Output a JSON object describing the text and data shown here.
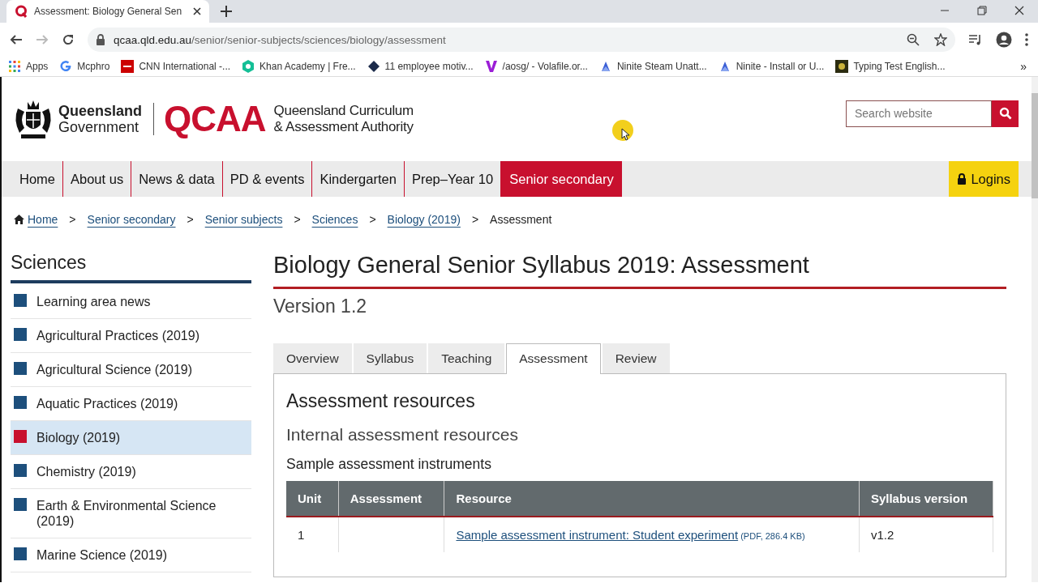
{
  "browser": {
    "tab": {
      "title": "Assessment: Biology General Sen",
      "selected": true
    },
    "url_host": "qcaa.qld.edu.au",
    "url_path": "/senior/senior-subjects/sciences/biology/assessment",
    "bookmarks": [
      {
        "label": "Apps",
        "kind": "apps"
      },
      {
        "label": "Mcphro",
        "kind": "g"
      },
      {
        "label": "CNN International -...",
        "kind": "cnn"
      },
      {
        "label": "Khan Academy | Fre...",
        "kind": "khan"
      },
      {
        "label": "11 employee motiv...",
        "kind": "diamond"
      },
      {
        "label": "/aosg/ - Volafile.or...",
        "kind": "v"
      },
      {
        "label": "Ninite Steam Unatt...",
        "kind": "ninite"
      },
      {
        "label": "Ninite - Install or U...",
        "kind": "ninite"
      },
      {
        "label": "Typing Test English...",
        "kind": "typing"
      }
    ],
    "more": "»"
  },
  "header": {
    "gov_line1": "Queensland",
    "gov_line2": "Government",
    "logo": "QCAA",
    "org_line1": "Queensland Curriculum",
    "org_line2": "& Assessment Authority",
    "search": {
      "placeholder": "Search website"
    }
  },
  "nav": {
    "items": [
      {
        "label": "Home",
        "selected": false
      },
      {
        "label": "About us",
        "selected": false
      },
      {
        "label": "News & data",
        "selected": false
      },
      {
        "label": "PD & events",
        "selected": false
      },
      {
        "label": "Kindergarten",
        "selected": false
      },
      {
        "label": "Prep–Year 10",
        "selected": false
      },
      {
        "label": "Senior secondary",
        "selected": true
      }
    ],
    "logins": "Logins"
  },
  "breadcrumb": {
    "links": [
      "Home",
      "Senior secondary",
      "Senior subjects",
      "Sciences",
      "Biology (2019)"
    ],
    "current": "Assessment",
    "separator": ">"
  },
  "sidebar": {
    "title": "Sciences",
    "items": [
      {
        "label": "Learning area news",
        "selected": false
      },
      {
        "label": "Agricultural Practices (2019)",
        "selected": false
      },
      {
        "label": "Agricultural Science (2019)",
        "selected": false
      },
      {
        "label": "Aquatic Practices (2019)",
        "selected": false
      },
      {
        "label": "Biology (2019)",
        "selected": true
      },
      {
        "label": "Chemistry (2019)",
        "selected": false
      },
      {
        "label": "Earth & Environmental Science (2019)",
        "selected": false
      },
      {
        "label": "Marine Science (2019)",
        "selected": false
      }
    ]
  },
  "main": {
    "title": "Biology General Senior Syllabus 2019: Assessment",
    "version": "Version 1.2",
    "tabs": [
      {
        "label": "Overview",
        "selected": false
      },
      {
        "label": "Syllabus",
        "selected": false
      },
      {
        "label": "Teaching",
        "selected": false
      },
      {
        "label": "Assessment",
        "selected": true
      },
      {
        "label": "Review",
        "selected": false
      }
    ],
    "h2": "Assessment resources",
    "h3": "Internal assessment resources",
    "h4": "Sample assessment instruments",
    "table": {
      "columns": [
        "Unit",
        "Assessment",
        "Resource",
        "Syllabus version"
      ],
      "rows": [
        {
          "unit": "1",
          "resource": "Sample assessment instrument: Student experiment",
          "resource_meta": "(PDF, 286.4 KB)",
          "version": "v1.2"
        }
      ]
    }
  }
}
